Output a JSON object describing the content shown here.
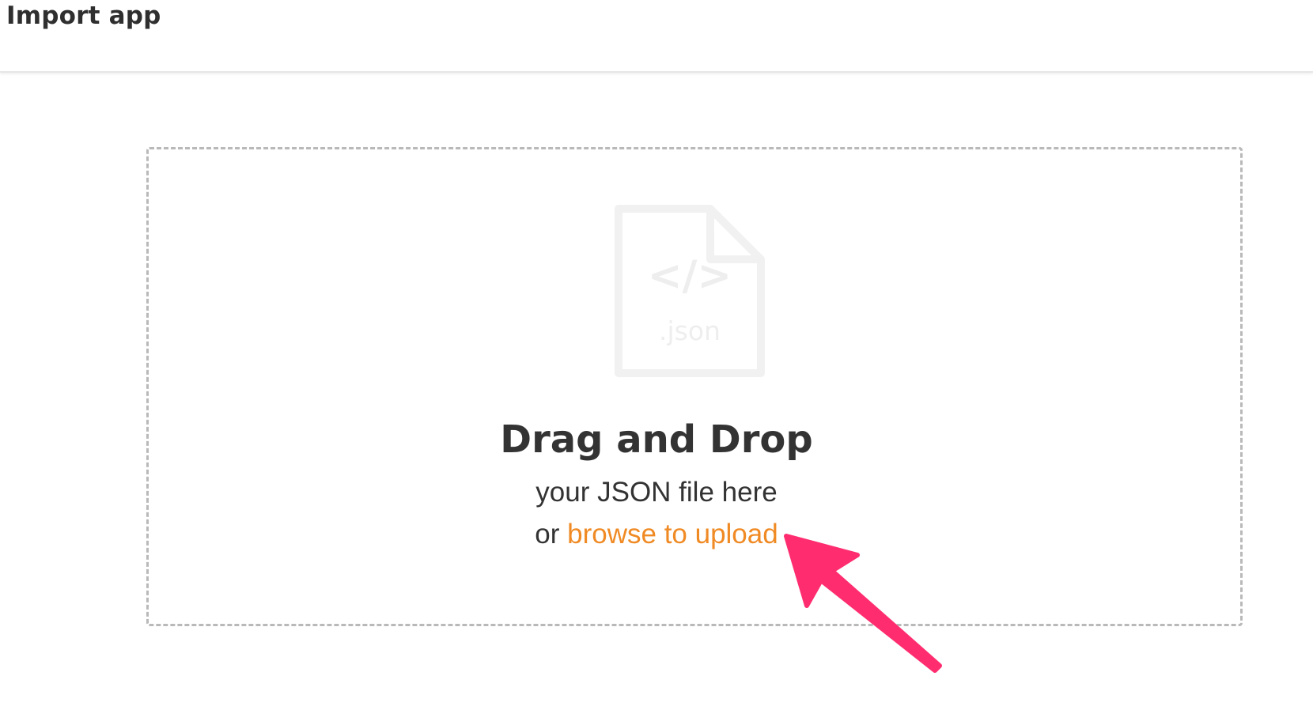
{
  "header": {
    "title": "Import app"
  },
  "dropzone": {
    "icon_code_glyph": "</>",
    "icon_ext_label": ".json",
    "heading": "Drag and Drop",
    "subtext": "your JSON file here",
    "or_text": "or",
    "browse_link_label": "browse to upload"
  },
  "colors": {
    "link": "#f08a24",
    "annotation_arrow": "#ff2d6f",
    "dash_border": "#b9b9b9",
    "icon_fill": "#f1f1f1"
  },
  "icons": {
    "file": "json-file-icon",
    "annotation": "pointer-arrow-annotation"
  }
}
